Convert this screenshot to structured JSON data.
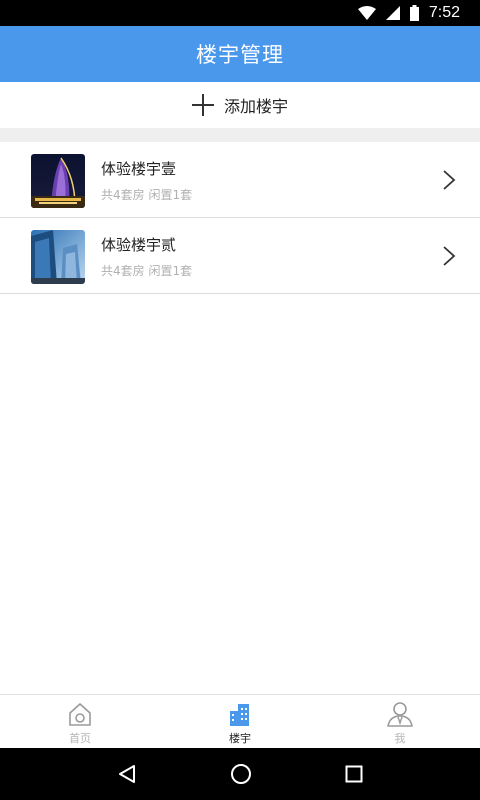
{
  "status_bar": {
    "time": "7:52"
  },
  "app_bar": {
    "title": "楼宇管理"
  },
  "add_row": {
    "label": "添加楼宇"
  },
  "buildings": [
    {
      "name": "体验楼宇壹",
      "summary": "共4套房 闲置1套",
      "thumbnail": "night-tower-photo"
    },
    {
      "name": "体验楼宇贰",
      "summary": "共4套房 闲置1套",
      "thumbnail": "glass-skyscraper-photo"
    }
  ],
  "tab_bar": {
    "tabs": [
      {
        "label": "首页",
        "icon": "home-icon",
        "active": false
      },
      {
        "label": "楼宇",
        "icon": "building-icon",
        "active": true
      },
      {
        "label": "我",
        "icon": "person-icon",
        "active": false
      }
    ]
  },
  "colors": {
    "primary": "#4a98ec",
    "divider": "#efefef",
    "subtext": "#b0b0b0"
  }
}
